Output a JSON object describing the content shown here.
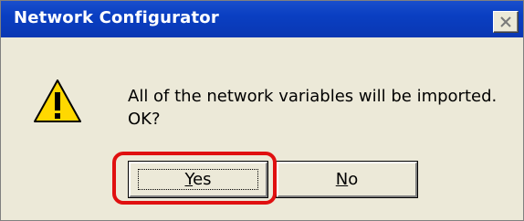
{
  "window": {
    "title": "Network Configurator"
  },
  "dialog": {
    "icon": "warning-icon",
    "message_line1": "All of the network variables will be imported.",
    "message_line2": "OK?"
  },
  "buttons": {
    "yes": {
      "label_mnemonic": "Y",
      "label_rest": "es"
    },
    "no": {
      "label_mnemonic": "N",
      "label_rest": "o"
    }
  },
  "colors": {
    "titlebar": "#0a3fc2",
    "dialog_bg": "#ece9d8",
    "highlight": "#e01010",
    "warning_fill": "#ffd800"
  }
}
